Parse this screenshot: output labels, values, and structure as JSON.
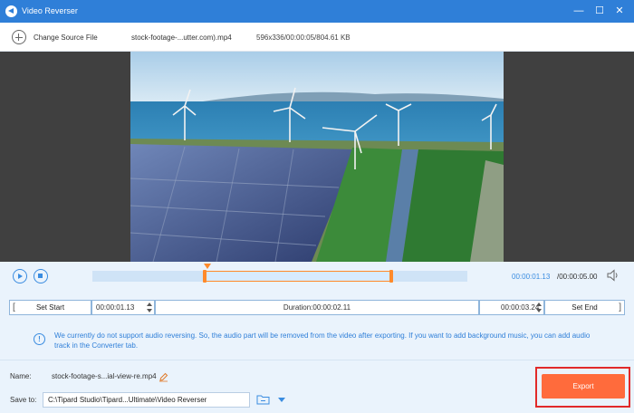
{
  "window": {
    "title": "Video Reverser",
    "minimize": "—",
    "maximize": "☐",
    "close": "✕"
  },
  "toolbar": {
    "change_source_label": "Change Source File",
    "file_name": "stock-footage-...utter.com).mp4",
    "file_meta": "596x336/00:00:05/804.61 KB"
  },
  "playback": {
    "current_time": "00:00:01.13",
    "total_time": "/00:00:05.00"
  },
  "trim": {
    "set_start_label": "Set Start",
    "start_time": "00:00:01.13",
    "duration": "Duration:00:00:02.11",
    "end_time": "00:00:03.24",
    "set_end_label": "Set End"
  },
  "notice": {
    "icon_text": "!",
    "text": "We currently do not support audio reversing. So, the audio part will be removed from the video after exporting. If you want to add background music, you can add audio track in the Converter tab."
  },
  "output": {
    "name_label": "Name:",
    "name_value": "stock-footage-s...ial-view-re.mp4",
    "save_to_label": "Save to:",
    "save_to_value": "C:\\Tipard Studio\\Tipard...Ultimate\\Video Reverser",
    "export_label": "Export"
  },
  "colors": {
    "accent": "#2f7fd8",
    "export": "#ff6b3c",
    "trim_handle": "#ff8a2a",
    "highlight_frame": "#e12a2a"
  },
  "icons": [
    "app-logo-icon",
    "add-icon",
    "play-icon",
    "stop-icon",
    "volume-icon",
    "info-icon",
    "pencil-icon",
    "dropdown-arrow-icon",
    "folder-icon"
  ]
}
